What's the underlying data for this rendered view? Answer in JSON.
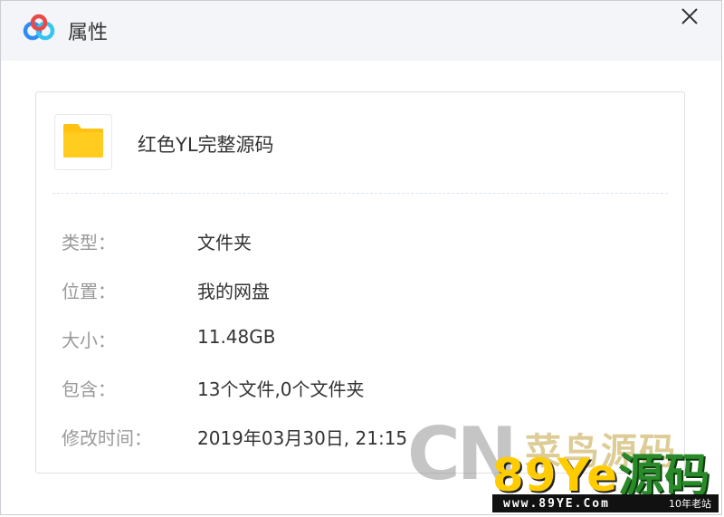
{
  "window": {
    "title": "属性",
    "app_icon": "cloud-logo-icon",
    "close_icon": "close-icon"
  },
  "file": {
    "name": "红色YL完整源码",
    "icon": "folder-icon"
  },
  "properties": [
    {
      "label": "类型：",
      "value": "文件夹"
    },
    {
      "label": "位置：",
      "value": "我的网盘"
    },
    {
      "label": "大小：",
      "value": "11.48GB"
    },
    {
      "label": "包含：",
      "value": "13个文件,0个文件夹"
    },
    {
      "label": "修改时间：",
      "value": "2019年03月30日, 21:15"
    }
  ],
  "watermark": {
    "cn": "CN",
    "cai": "菜鸟源码",
    "brand": "89Ye",
    "brand_src": "源码",
    "url": "www.89YE.Com",
    "tag": "10年老站"
  },
  "colors": {
    "titlebar_bg": "#f3f5f8",
    "label_text": "#999999",
    "value_text": "#333333",
    "folder_yellow": "#ffc20e"
  }
}
